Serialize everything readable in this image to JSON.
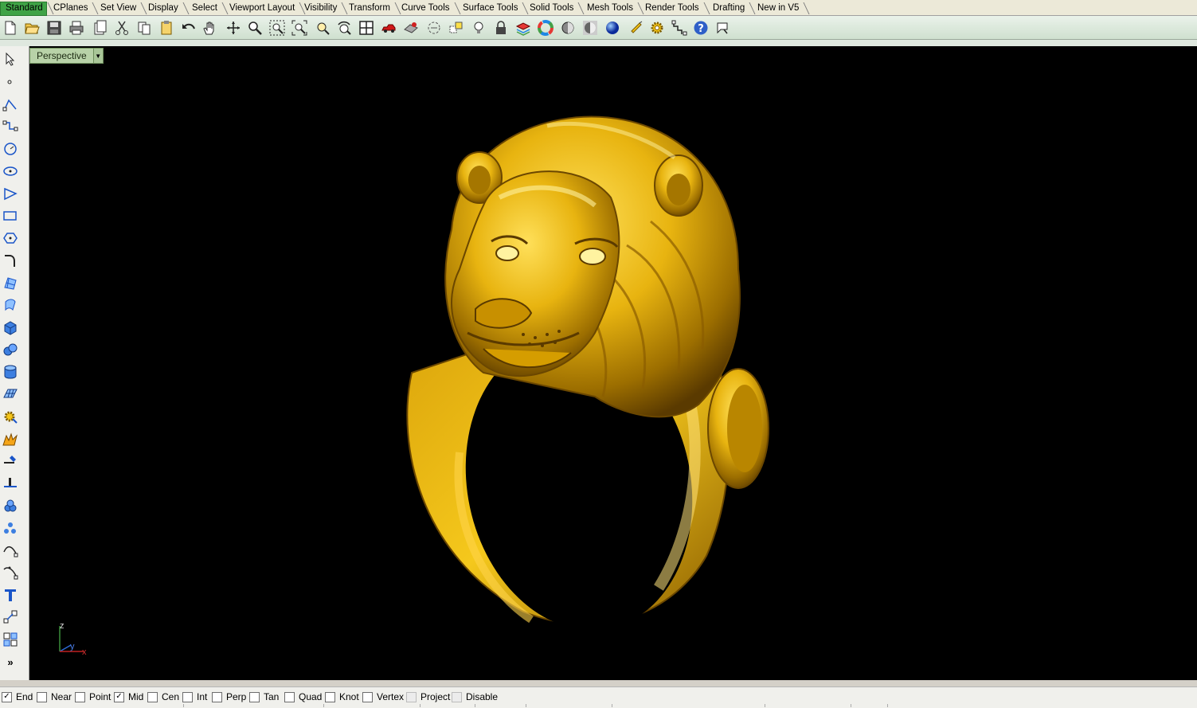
{
  "tabs": [
    "Standard",
    "CPlanes",
    "Set View",
    "Display",
    "Select",
    "Viewport Layout",
    "Visibility",
    "Transform",
    "Curve Tools",
    "Surface Tools",
    "Solid Tools",
    "Mesh Tools",
    "Render Tools",
    "Drafting",
    "New in V5"
  ],
  "active_tab": "Standard",
  "toolbar_icons": [
    "new-file-icon",
    "open-file-icon",
    "save-icon",
    "print-icon",
    "properties-icon",
    "cut-icon",
    "copy-icon",
    "paste-icon",
    "undo-icon",
    "pan-hand-icon",
    "rotate-view-icon",
    "zoom-dynamic-icon",
    "zoom-window-icon",
    "zoom-extents-icon",
    "zoom-selected-icon",
    "undo-view-icon",
    "four-viewports-icon",
    "car-icon",
    "object-properties-icon",
    "hide-objects-icon",
    "show-objects-icon",
    "light-icon",
    "lock-icon",
    "layer-icon",
    "color-wheel-icon",
    "render-preview-icon",
    "ghosted-icon",
    "render-sphere-icon",
    "filter-icon",
    "options-gear-icon",
    "grid-snap-icon",
    "help-icon",
    "toolbar-tips-icon"
  ],
  "left_tools": [
    "select-arrow-icon",
    "point-icon",
    "polyline-icon",
    "curve-icon",
    "circle-icon",
    "ellipse-icon",
    "arc-icon",
    "rectangle-icon",
    "polygon-icon",
    "fillet-curve-icon",
    "surface-pts-icon",
    "extrude-surface-icon",
    "box-solid-icon",
    "boolean-union-icon",
    "cylinder-icon",
    "mesh-plane-icon",
    "solid-edit-icon",
    "explode-icon",
    "split-icon",
    "trim-icon",
    "group-icon",
    "array-icon",
    "control-points-icon",
    "edit-points-icon",
    "text-icon",
    "scale-icon",
    "transform-icon"
  ],
  "left_more": "»",
  "viewport": {
    "label": "Perspective",
    "background": "#000000",
    "model_color": "#e8b410",
    "axes": {
      "z": "z",
      "y": "y",
      "x": "x"
    }
  },
  "status": {
    "snaps": [
      {
        "label": "End",
        "checked": true,
        "enabled": true
      },
      {
        "label": "Near",
        "checked": false,
        "enabled": true
      },
      {
        "label": "Point",
        "checked": false,
        "enabled": true
      },
      {
        "label": "Mid",
        "checked": true,
        "enabled": true
      },
      {
        "label": "Cen",
        "checked": false,
        "enabled": true
      },
      {
        "label": "Int",
        "checked": false,
        "enabled": true
      },
      {
        "label": "Perp",
        "checked": false,
        "enabled": true
      },
      {
        "label": "Tan",
        "checked": false,
        "enabled": true
      },
      {
        "label": "Quad",
        "checked": false,
        "enabled": true
      },
      {
        "label": "Knot",
        "checked": false,
        "enabled": true
      },
      {
        "label": "Vertex",
        "checked": false,
        "enabled": true
      },
      {
        "label": "Project",
        "checked": false,
        "enabled": false
      },
      {
        "label": "Disable",
        "checked": false,
        "enabled": false
      }
    ]
  }
}
